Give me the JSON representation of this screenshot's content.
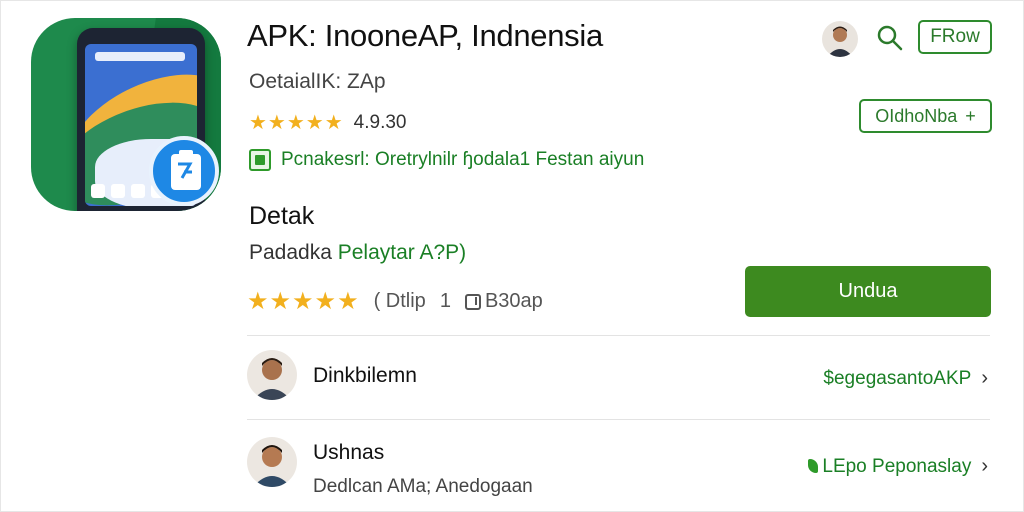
{
  "app": {
    "title": "APK: InooneAP, Indnensia",
    "subtitle": "OetaialΙΚ: ΖΑp",
    "rating_value": "4.9.30",
    "feature_text": "Pcnakesrl: Oretrylnilr ɧodala1 Festan aiyun"
  },
  "header": {
    "follow_label": "FRow",
    "secondary_label": "ΟΙdhoNba",
    "secondary_arrow": "+"
  },
  "details": {
    "heading": "Detak",
    "publisher_prefix": "Padadka",
    "publisher_link": "Pelaytar A?P)",
    "rating_paren": "( Dtlip",
    "downloads_count": "1",
    "downloads_size": "B30ap"
  },
  "download_button": {
    "label": "Undua"
  },
  "list": [
    {
      "name": "Dinkbilemn",
      "meta": "",
      "link": "$egegasantoAKP",
      "chevron": "›"
    },
    {
      "name": "Ushnas",
      "meta": "Dedlcan AMa; Anedogaan",
      "link": "LEpo Peponaslay",
      "chevron": "›"
    }
  ],
  "icons": {
    "search": "search-icon",
    "avatar": "avatar",
    "feature": "app-feature-icon"
  },
  "colors": {
    "accent_green": "#3d8a1f",
    "link_green": "#1a7f25",
    "star": "#f2b01e",
    "icon_bg": "#1e8a4c"
  }
}
